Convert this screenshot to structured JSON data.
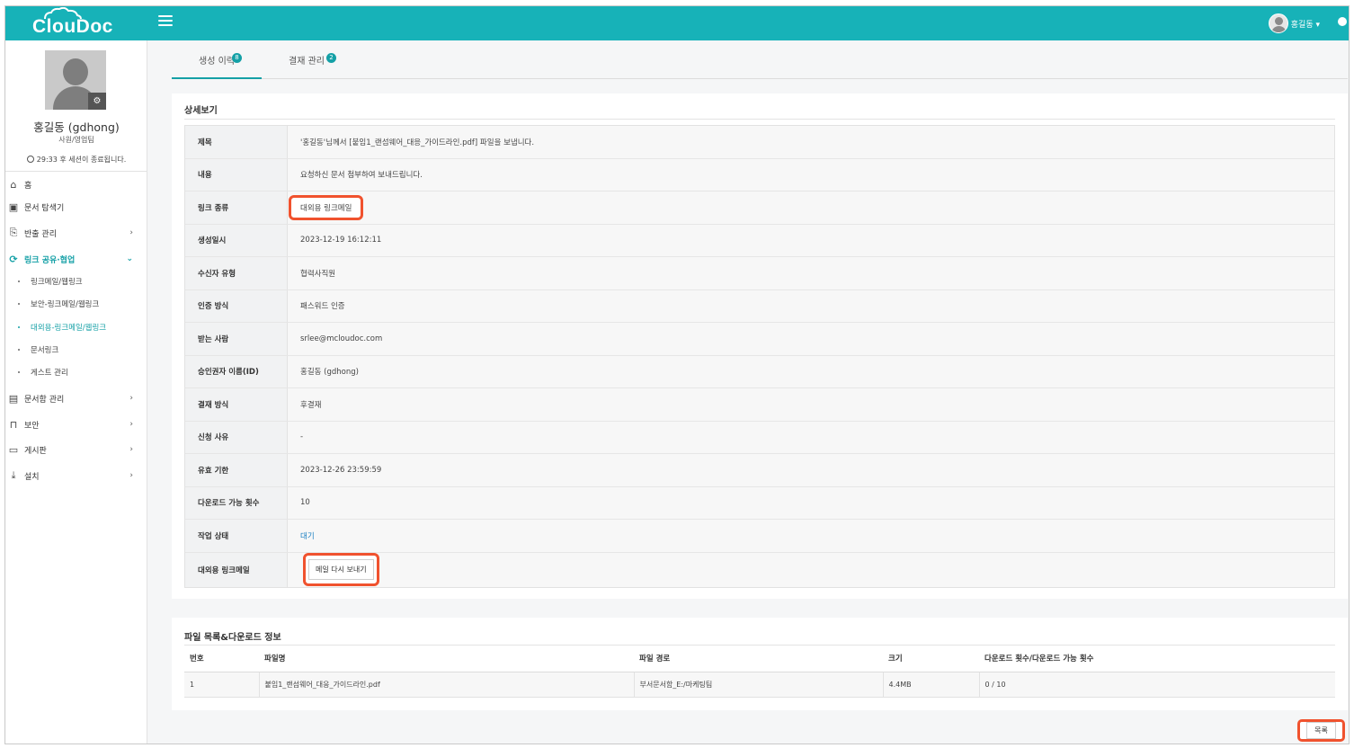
{
  "app": {
    "logo_text": "ClouDoc",
    "colors": {
      "primary": "#17b2b8",
      "accent": "#14a0a6",
      "highlight": "#f0522e",
      "link_status": "#1a7fc2"
    }
  },
  "header": {
    "menu_icon": "hamburger-icon",
    "user_label": "홍길동 ▾"
  },
  "profile": {
    "name": "홍길동 (gdhong)",
    "dept": "사원/영업팀",
    "session": "29:33 후 세션이 종료됩니다."
  },
  "nav": {
    "home": "홈",
    "explorer": "문서 탐색기",
    "export": "반출 관리",
    "link_share": "링크 공유·협업",
    "sub": [
      "링크메일/웹링크",
      "보안-링크메일/웹링크",
      "대외용-링크메일/웹링크",
      "문서링크",
      "게스트 관리"
    ],
    "docbox": "문서함 관리",
    "security": "보안",
    "board": "게시판",
    "install": "설치"
  },
  "tabs": [
    {
      "label": "생성 이력",
      "badge": "8"
    },
    {
      "label": "결재 관리",
      "badge": "2"
    }
  ],
  "detail": {
    "title": "상세보기",
    "rows": [
      {
        "label": "제목",
        "value": "'홍길동'님께서 [붙임1_랜섬웨어_대응_가이드라인.pdf] 파일을 보냅니다."
      },
      {
        "label": "내용",
        "value": "요청하신 문서 첨부하여 보내드립니다."
      },
      {
        "label": "링크 종류",
        "value": "대외용 링크메일"
      },
      {
        "label": "생성일시",
        "value": "2023-12-19 16:12:11"
      },
      {
        "label": "수신자 유형",
        "value": "협력사직원"
      },
      {
        "label": "인증 방식",
        "value": "패스워드 인증"
      },
      {
        "label": "받는 사람",
        "value": "srlee@mcloudoc.com"
      },
      {
        "label": "승인권자 이름(ID)",
        "value": "홍길동 (gdhong)"
      },
      {
        "label": "결재 방식",
        "value": "후결재"
      },
      {
        "label": "신청 사유",
        "value": "-"
      },
      {
        "label": "유효 기한",
        "value": "2023-12-26 23:59:59"
      },
      {
        "label": "다운로드 가능 횟수",
        "value": "10"
      },
      {
        "label": "작업 상태",
        "value": "대기"
      },
      {
        "label": "대외용 링크메일",
        "value": "메일 다시 보내기"
      }
    ]
  },
  "files": {
    "title": "파일 목록&다운로드 정보",
    "columns": [
      "번호",
      "파일명",
      "파일 경로",
      "크기",
      "다운로드 횟수/다운로드 가능 횟수"
    ],
    "rows": [
      [
        "1",
        "붙임1_랜섬웨어_대응_가이드라인.pdf",
        "부서문서함_E:/마케팅팀",
        "4.4MB",
        "0 / 10"
      ]
    ]
  },
  "list_button": "목록"
}
